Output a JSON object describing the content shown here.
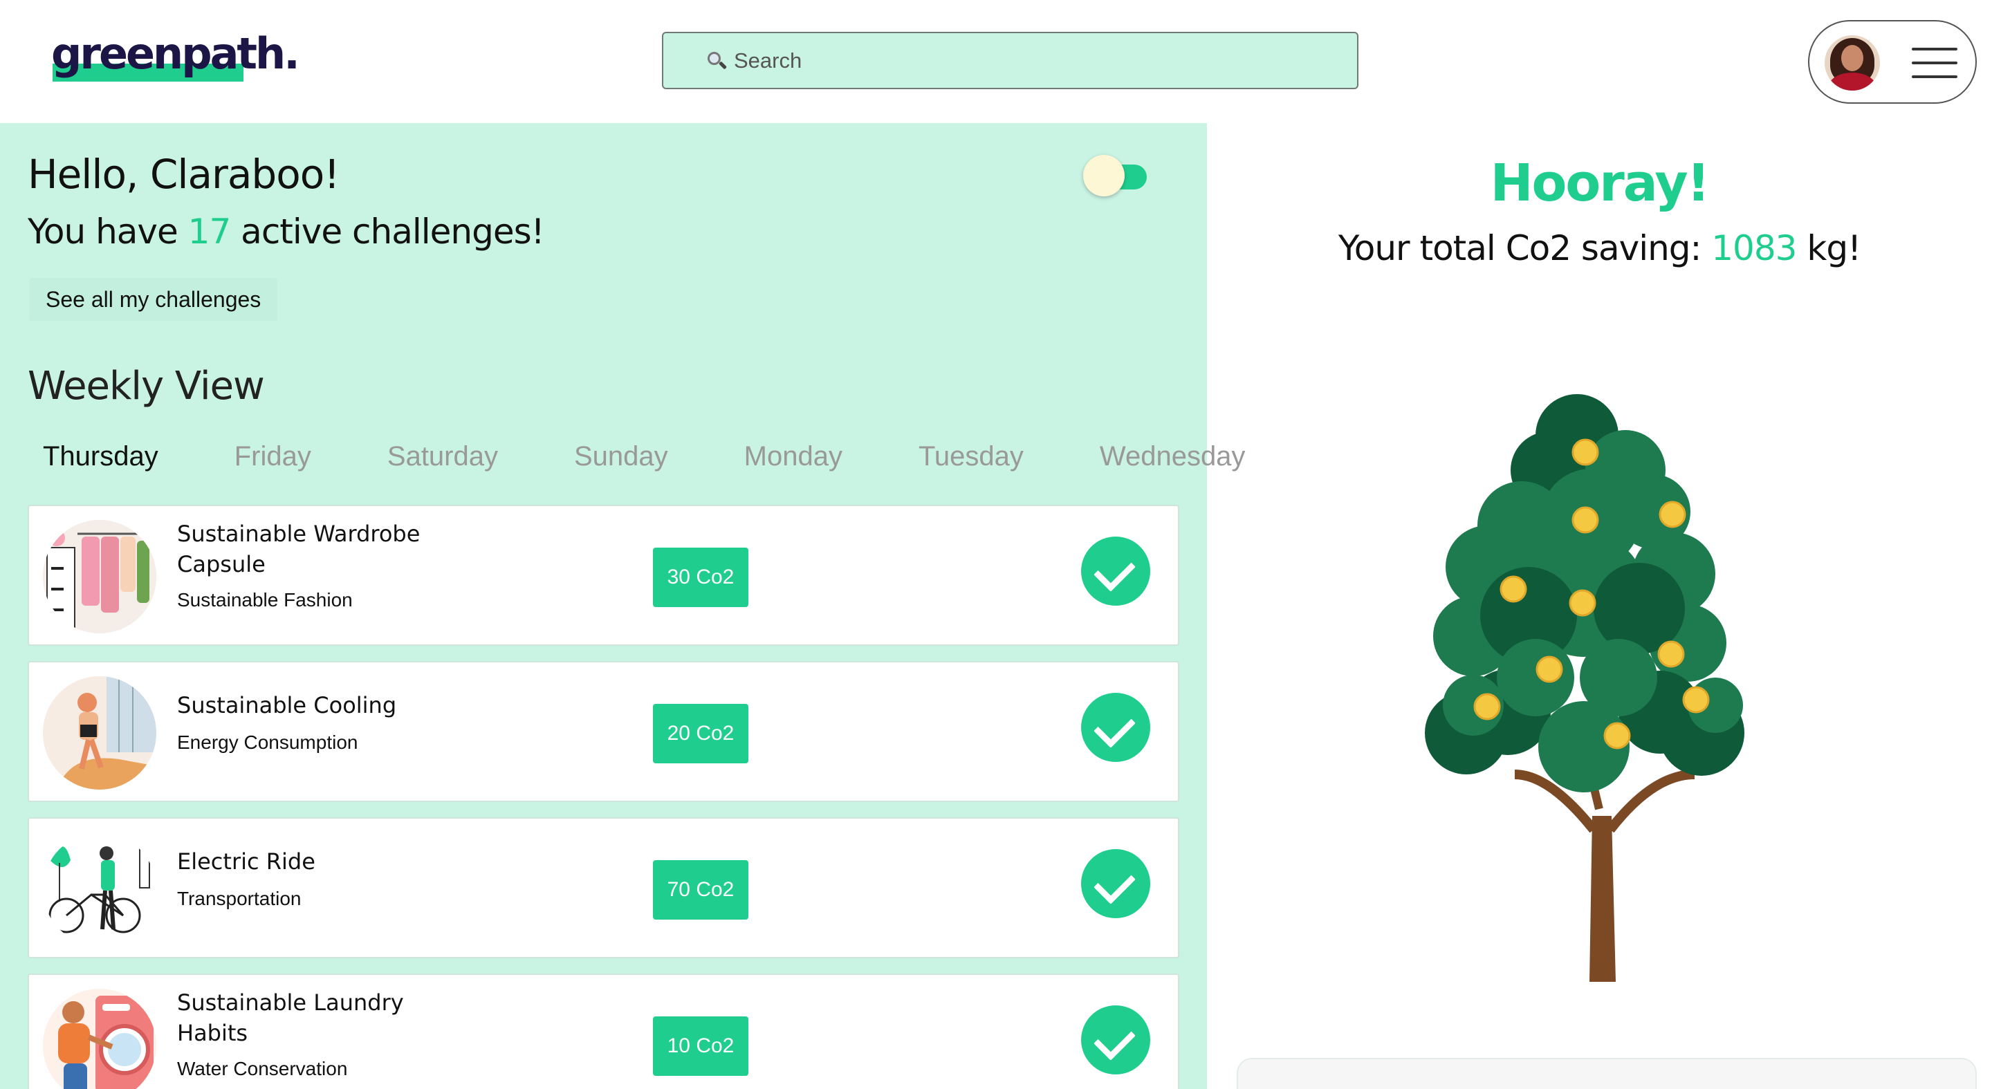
{
  "header": {
    "logo": "greenpath.",
    "search_placeholder": "Search",
    "menu_icon": "hamburger-icon",
    "search_icon": "magnifier-icon"
  },
  "dashboard": {
    "greeting": "Hello, Claraboo!",
    "active_prefix": "You have ",
    "active_count": "17",
    "active_suffix": " active challenges!",
    "see_all_label": "See all my challenges",
    "weekly_title": "Weekly View",
    "selected_day": "Thursday",
    "days": [
      "Thursday",
      "Friday",
      "Saturday",
      "Sunday",
      "Monday",
      "Tuesday",
      "Wednesday"
    ]
  },
  "challenges": [
    {
      "title": "Sustainable Wardrobe Capsule",
      "category": "Sustainable Fashion",
      "co2": "30 Co2",
      "completed": true
    },
    {
      "title": "Sustainable Cooling",
      "category": "Energy Consumption",
      "co2": "20 Co2",
      "completed": true
    },
    {
      "title": "Electric Ride",
      "category": "Transportation",
      "co2": "70 Co2",
      "completed": true
    },
    {
      "title": "Sustainable Laundry Habits",
      "category": "Water Conservation",
      "co2": "10 Co2",
      "completed": true
    }
  ],
  "summary": {
    "hooray": "Hooray!",
    "saving_prefix": "Your total Co2 saving: ",
    "saving_value": "1083",
    "saving_suffix": " kg!"
  },
  "colors": {
    "accent": "#1fce8f",
    "panel_bg": "#c9f3e3",
    "logo_text": "#1b1646",
    "tree_dark": "#0f5a38",
    "tree_mid": "#1e7a4f",
    "trunk": "#7b4a24",
    "coin": "#f5c842"
  }
}
